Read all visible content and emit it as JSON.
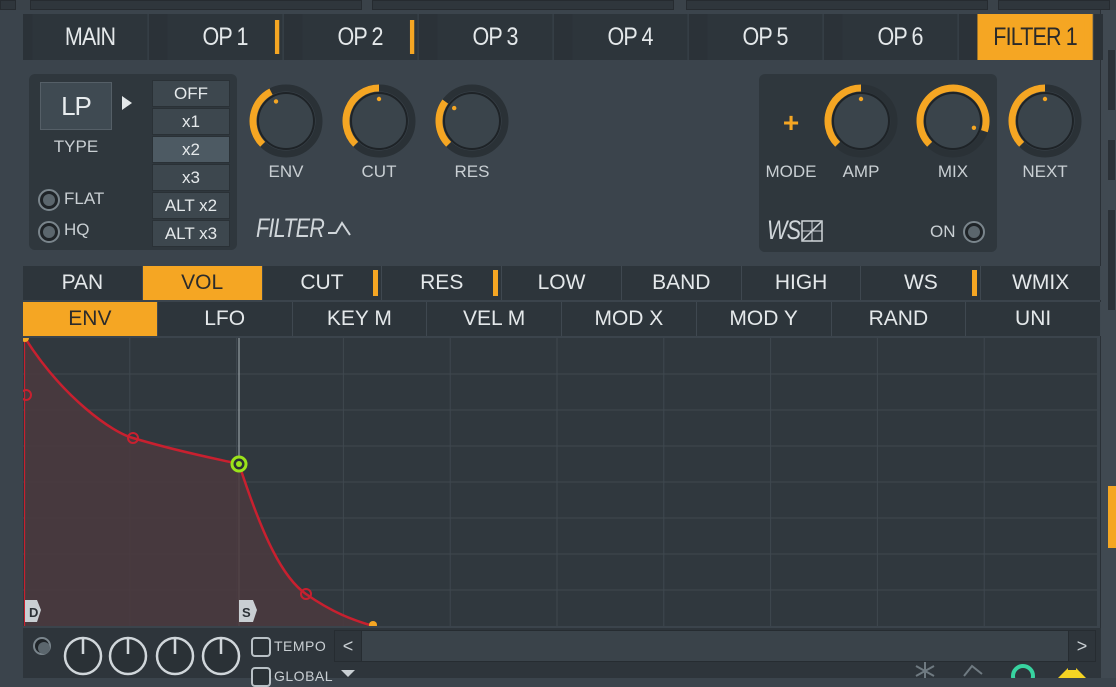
{
  "op_tabs": [
    {
      "label": "MAIN",
      "marked": false,
      "active": false
    },
    {
      "label": "OP 1",
      "marked": true,
      "active": false
    },
    {
      "label": "OP 2",
      "marked": true,
      "active": false
    },
    {
      "label": "OP 3",
      "marked": false,
      "active": false
    },
    {
      "label": "OP 4",
      "marked": false,
      "active": false
    },
    {
      "label": "OP 5",
      "marked": false,
      "active": false
    },
    {
      "label": "OP 6",
      "marked": false,
      "active": false
    },
    {
      "label": "FILTER 1",
      "marked": true,
      "active": true
    }
  ],
  "filter": {
    "type_value": "LP",
    "type_label": "TYPE",
    "oversample_options": [
      "OFF",
      "x1",
      "x2",
      "x3",
      "ALT x2",
      "ALT x3"
    ],
    "oversample_selected": "x2",
    "flat_label": "FLAT",
    "hq_label": "HQ",
    "knobs": [
      {
        "label": "ENV",
        "level": 0.4
      },
      {
        "label": "CUT",
        "level": 0.5
      },
      {
        "label": "RES",
        "level": 0.3
      }
    ],
    "section_title": "FILTER"
  },
  "waveshaper": {
    "mode_symbol": "+",
    "mode_label": "MODE",
    "knobs": [
      {
        "label": "AMP",
        "level": 0.5
      },
      {
        "label": "MIX",
        "level": 0.9
      }
    ],
    "next_label": "NEXT",
    "section_title": "WS",
    "on_label": "ON"
  },
  "target_tabs": [
    {
      "label": "PAN",
      "marked": false,
      "active": false
    },
    {
      "label": "VOL",
      "marked": true,
      "active": true
    },
    {
      "label": "CUT",
      "marked": true,
      "active": false
    },
    {
      "label": "RES",
      "marked": true,
      "active": false
    },
    {
      "label": "LOW",
      "marked": false,
      "active": false
    },
    {
      "label": "BAND",
      "marked": false,
      "active": false
    },
    {
      "label": "HIGH",
      "marked": false,
      "active": false
    },
    {
      "label": "WS",
      "marked": true,
      "active": false
    },
    {
      "label": "WMIX",
      "marked": false,
      "active": false
    }
  ],
  "source_tabs": [
    {
      "label": "ENV",
      "marked": true,
      "active": true
    },
    {
      "label": "LFO",
      "marked": false,
      "active": false
    },
    {
      "label": "KEY M",
      "marked": false,
      "active": false
    },
    {
      "label": "VEL M",
      "marked": false,
      "active": false
    },
    {
      "label": "MOD X",
      "marked": false,
      "active": false
    },
    {
      "label": "MOD Y",
      "marked": false,
      "active": false
    },
    {
      "label": "RAND",
      "marked": false,
      "active": false
    },
    {
      "label": "UNI",
      "marked": false,
      "active": false
    }
  ],
  "envelope": {
    "decay_marker": "D",
    "sustain_marker": "S",
    "curve_color": "#c8202f",
    "sustain_point_color": "#9be31a",
    "fill_color": "#4a3a3e"
  },
  "bottom": {
    "tempo_label": "TEMPO",
    "global_label": "GLOBAL",
    "scroll_left": "<",
    "scroll_right": ">",
    "icons": [
      "snowflake-icon",
      "bucket-icon",
      "clock-icon",
      "arrows-icon"
    ]
  },
  "colors": {
    "accent": "#f5a623",
    "panel": "#2f373d",
    "background": "#3b444c"
  }
}
